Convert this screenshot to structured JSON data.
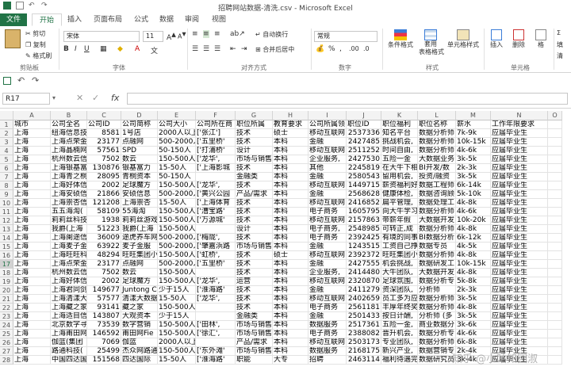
{
  "window": {
    "title": "招聘网站数据-清洗.csv - Microsoft Excel"
  },
  "tabs": [
    "文件",
    "开始",
    "插入",
    "页面布局",
    "公式",
    "数据",
    "审阅",
    "视图"
  ],
  "ribbon": {
    "clipboard": {
      "cut": "剪切",
      "copy": "复制",
      "format_painter": "格式刷",
      "label": "剪贴板"
    },
    "font": {
      "name": "宋体",
      "size": "11",
      "label": "字体"
    },
    "alignment": {
      "wrap": "自动换行",
      "merge": "合并后居中",
      "label": "对齐方式"
    },
    "number": {
      "format": "常规",
      "label": "数字"
    },
    "styles": {
      "conditional": "条件格式",
      "table": "套用\n表格格式",
      "cell": "单元格样式",
      "label": "样式"
    },
    "cells": {
      "insert": "插入",
      "delete": "删除",
      "format": "格",
      "label": "单元格"
    },
    "editing": {
      "fill": "填",
      "clear": "清"
    }
  },
  "formula_bar": {
    "name_box": "R17",
    "fx": "fx",
    "value": ""
  },
  "columns": [
    "A",
    "B",
    "C",
    "D",
    "E",
    "F",
    "G",
    "H",
    "I",
    "J",
    "K",
    "L",
    "M",
    "N",
    "O"
  ],
  "rows": [
    [
      "城市",
      "公司全名",
      "公司ID",
      "公司简称",
      "公司大小",
      "公司所在商",
      "职位所属",
      "教育要求",
      "公司所属领",
      "职位ID",
      "职位福利",
      "职位名称",
      "薪水",
      "工作年限要求",
      ""
    ],
    [
      "上海",
      "纽海信息技",
      "8581",
      "1号店",
      "2000人以上",
      "['张江']",
      "技术",
      "硕士",
      "移动互联网",
      "2537336",
      "知名平台",
      "数据分析师",
      "7k-9k",
      "应届毕业生",
      ""
    ],
    [
      "上海",
      "上海点荣金",
      "23177",
      "点融网",
      "500-2000人",
      "['五里桥'",
      "技术",
      "本科",
      "金融",
      "2427485",
      "挑战机会,",
      "数据分析师",
      "10k-15k",
      "应届毕业生",
      ""
    ],
    [
      "上海",
      "上海晶楠网",
      "57561",
      "SPD",
      "50-150人",
      "['打浦桥'",
      "设计",
      "本科",
      "移动互联网",
      "2511252",
      "时间自由,",
      "数据分析师",
      "4k-6k",
      "应届毕业生",
      ""
    ],
    [
      "上海",
      "杭州数云信",
      "7502",
      "数云",
      "150-500人",
      "['龙华',",
      "市场与销售",
      "本科",
      "企业服务,",
      "2427530",
      "五险一金",
      "大数据业务",
      "3k-5k",
      "应届毕业生",
      ""
    ],
    [
      "上海",
      "上海银基富",
      "130876",
      "银基富力",
      "15-50人",
      "['上海影城",
      "技术",
      "本科",
      "其他",
      "2245819",
      "在大牛下相",
      "BI开发/数",
      "2k-3k",
      "应届毕业生",
      ""
    ],
    [
      "上海",
      "上海青之桐",
      "28095",
      "青桐资本",
      "50-150人",
      "",
      "金融类",
      "本科",
      "金融",
      "2580543",
      "留用机会,",
      "投资/融资",
      "3k-5k",
      "应届毕业生",
      ""
    ],
    [
      "上海",
      "上海好体信",
      "2002",
      "足球魔方",
      "150-500人",
      "['龙华',",
      "技术",
      "本科",
      "移动互联网",
      "1449715",
      "薪资福利好",
      "数据工程师",
      "6k-14k",
      "应届毕业生",
      ""
    ],
    [
      "上海",
      "上海安硕信",
      "21866",
      "安硕信息",
      "500-2000人",
      "['黄兴公园",
      "产品/需求",
      "本科",
      "金融",
      "2568628",
      "健康体检,",
      "数据咨询顾",
      "5k-10k",
      "应届毕业生",
      ""
    ],
    [
      "上海",
      "上海崇杏信",
      "121208",
      "上海崇杏",
      "15-50人",
      "['上海体育",
      "技术",
      "本科",
      "移动互联网",
      "2416852",
      "扁平管理,",
      "数据处理工",
      "4k-8k",
      "应届毕业生",
      ""
    ],
    [
      "上海",
      "五五海淘(",
      "58109",
      "55海淘",
      "150-500人",
      "['漕宝路'",
      "技术",
      "本科",
      "电子商务",
      "1605795",
      "向大牛学习",
      "数据分析师",
      "4k-6k",
      "应届毕业生",
      ""
    ],
    [
      "上海",
      "莉莉丝科技",
      "1938",
      "莉莉丝游戏",
      "150-500人",
      "['万源城'",
      "技术",
      "本科",
      "移动互联网",
      "2157863",
      "带薪年假",
      "大数据开发",
      "10k-20k",
      "应届毕业生",
      ""
    ],
    [
      "上海",
      "我爵(上海",
      "51223",
      "我爵(上海",
      "150-500人",
      "",
      "设计",
      "本科",
      "电子商务,",
      "2548985",
      "可转正,成",
      "数据分析师",
      "4k-8k",
      "应届毕业生",
      ""
    ],
    [
      "上海",
      "上海阑途信",
      "36009",
      "途虎养车网",
      "500-2000人",
      "['梅陇',",
      "技术",
      "本科",
      "电子商务",
      "2392425",
      "有境的同事",
      "BI数据分析",
      "6k-12k",
      "应届毕业生",
      ""
    ],
    [
      "上海",
      "上海麦子金",
      "63922",
      "麦子金服",
      "500-2000人",
      "['肇嘉浜路",
      "市场与销售",
      "本科",
      "金融",
      "1243515",
      "工资自己挣",
      "数据专员",
      "4k-5k",
      "应届毕业生",
      ""
    ],
    [
      "上海",
      "上海旺旺科",
      "48294",
      "旺旺集团小",
      "150-500人",
      "['虹桥',",
      "技术",
      "硕士",
      "移动互联网",
      "2392372",
      "旺旺集团小",
      "数据分析师",
      "4k-8k",
      "应届毕业生",
      ""
    ],
    [
      "上海",
      "上海点荣金",
      "23177",
      "点融网",
      "500-2000人",
      "['五里桥'",
      "技术",
      "本科",
      "金融",
      "2427555",
      "机会挑战,",
      "数据研发工",
      "10k-15k",
      "应届毕业生",
      ""
    ],
    [
      "上海",
      "杭州数云信",
      "7502",
      "数云",
      "150-500人",
      "",
      "技术",
      "本科",
      "企业服务,",
      "2414480",
      "大牛团队,",
      "大数据开发",
      "4k-8k",
      "应届毕业生",
      ""
    ],
    [
      "上海",
      "上海好体信",
      "2002",
      "足球魔方",
      "150-500人",
      "['龙华',",
      "运营",
      "本科",
      "移动互联网",
      "2320870",
      "足球氛围,",
      "数据分析专",
      "5k-8k",
      "应届毕业生",
      ""
    ],
    [
      "上海",
      "上海君同剑",
      "149677",
      "Juntong C",
      "少于15人",
      "['淮海路'",
      "技术",
      "本科",
      "金融",
      "2411279",
      "资深团队,",
      "分析师",
      "2k-3k",
      "应届毕业生",
      ""
    ],
    [
      "上海",
      "上海清漾大",
      "57577",
      "清漾大数据",
      "15-50人",
      "['龙华',",
      "技术",
      "本科",
      "移动互联网",
      "2402659",
      "员工多为应",
      "数据分析师",
      "3k-5k",
      "应届毕业生",
      ""
    ],
    [
      "上海",
      "上海藏之家",
      "93141",
      "藏之家",
      "150-500人",
      "",
      "技术",
      "本科",
      "电子商务",
      "2561181",
      "丰厚年终奖",
      "数据分析师",
      "4k-8k",
      "应届毕业生",
      ""
    ],
    [
      "上海",
      "上海适目信",
      "143807",
      "大观资本",
      "少于15人",
      "",
      "金融类",
      "本科",
      "金融",
      "2501433",
      "按日计酬,",
      "分析师 (多",
      "3k-5k",
      "应届毕业生",
      ""
    ],
    [
      "上海",
      "北京数字寻",
      "73539",
      "数字营销",
      "150-500人",
      "['田林',",
      "市场与销售",
      "本科",
      "数据服务",
      "2517361",
      "五险一金,",
      "商业数据分",
      "3k-6k",
      "应届毕业生",
      ""
    ],
    [
      "上海",
      "上海甫田网",
      "146592",
      "甫田网Fie",
      "150-500人",
      "['徐汇',",
      "市场与销售",
      "本科",
      "电子商务",
      "2388082",
      "晋升机会,",
      "数据分析专",
      "4k-6k",
      "应届毕业生",
      ""
    ],
    [
      "上海",
      "伽蓝(集团",
      "7069",
      "伽蓝",
      "2000人以上",
      "",
      "产品/需求",
      "本科",
      "移动互联网",
      "2503173",
      "专业团队,",
      "数据分析师",
      "6k-8k",
      "应届毕业生",
      ""
    ],
    [
      "上海",
      "路通科技(",
      "25499",
      "杰众网路通",
      "150-500人",
      "['东外滩'",
      "市场与销售",
      "本科",
      "数据服务",
      "2168175",
      "新兴产业,",
      "数据营销专",
      "2k-4k",
      "应届毕业生",
      ""
    ],
    [
      "上海",
      "中国四达国",
      "151568",
      "四达国际",
      "15-50人",
      "['淮海路'",
      "职能",
      "大专",
      "招聘",
      "2463114",
      "福利待遇完",
      "数据研究员",
      "3k-4k",
      "应届毕业生",
      ""
    ]
  ],
  "selected_row": "17",
  "watermark": "知乎 @小咕知团淑"
}
